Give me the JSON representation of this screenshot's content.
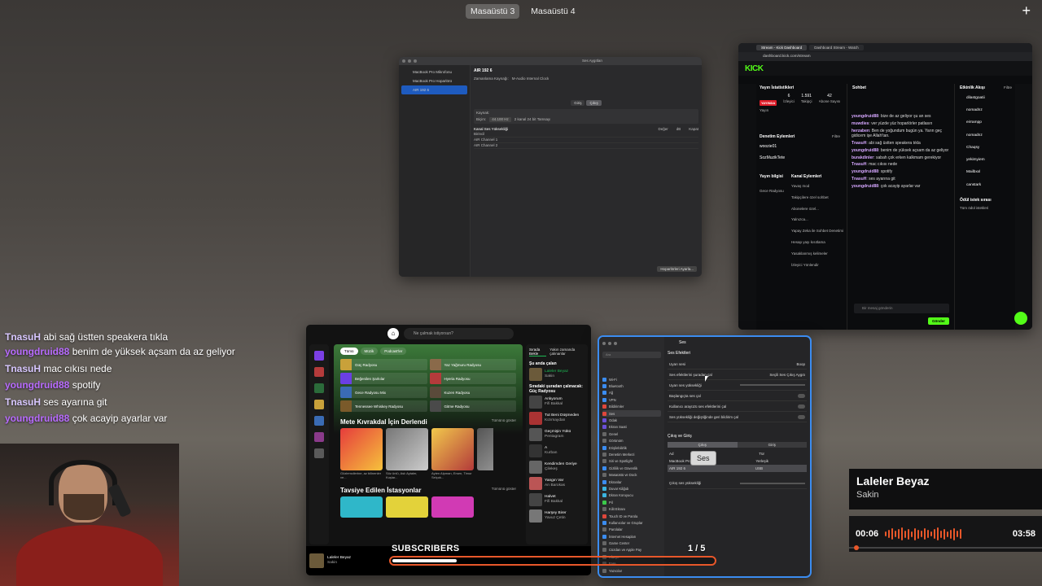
{
  "desktops": {
    "items": [
      "Masaüstü 3",
      "Masaüstü 4"
    ],
    "active": "Masaüstü 3"
  },
  "sound_window": {
    "title": "Ses Aygıtları",
    "devices": [
      "MacBook Pro Mikrofonu",
      "MacBook Pro Hoparlörü",
      "AIR 192 6"
    ],
    "selected_device": "AIR 192 6",
    "device_header": "AIR 192 6",
    "clock_source": "Zamanlama Kaynağı:",
    "clock_value": "M-Audio Internal Clock",
    "tab_input": "Giriş",
    "tab_output": "Çıkış",
    "source_label": "Kaynak:",
    "format_label": "Biçim:",
    "format_rate": "44.100 Hz",
    "format_bits": "2 kanal 24 bit Tamsayı",
    "channel_header": "Kanal Ses Yüksekliği",
    "channel_cols": [
      "Değer",
      "dB",
      "Kapat"
    ],
    "channels": [
      "Birincil",
      "AIR Channel 1",
      "AIR Channel 2"
    ],
    "configure_button": "Hoparlörleri Ayarla..."
  },
  "kick": {
    "tabs": [
      "Stream - Kick Dashboard",
      "Dashboard Stream - Watch"
    ],
    "url": "dashboard.kick.com/stream",
    "stream_info_title": "Yayın İstatistikleri",
    "live_badge": "YAYINDA",
    "stats": [
      {
        "value": "6",
        "label": "İzleyici"
      },
      {
        "value": "1.591",
        "label": "Takipçi"
      },
      {
        "value": "42",
        "label": "Abone Sayısı"
      }
    ],
    "stats_first_label": "Yayın",
    "moderation_title": "Denetim Eylemleri",
    "filter": "Filtre",
    "mod_actions": [
      "woozie01",
      "SozMuzikTete"
    ],
    "stream_title_label": "Yayın bilgisi",
    "channel_actions_title": "Kanal Eylemleri",
    "channel_actions": [
      "Yavaş mod",
      "Takipçilere özel sohbet",
      "Abonelere özel...",
      "Yalnızca...",
      "Yapay Zeka ile Sohbet Denetimi",
      "Hesap yaşı kısıtlama",
      "Yasaklanmış kelimeler",
      "İzleyici Yönlendir"
    ],
    "category": "Gece Radyosu",
    "chat_title": "Sohbet",
    "chat_lines": [
      {
        "user": "youngdruid88",
        "msg": "bize de az geliyor şu an ses"
      },
      {
        "user": "muwdies",
        "msg": "ver yüzde yüz hoparlörler patlasın"
      },
      {
        "user": "herzaben",
        "msg": "Ben de yoğundum bugün ya. Yarın geç gidicem işe Allah'tan."
      },
      {
        "user": "TnasuH",
        "msg": "abi sağ üstten speakera tıkla"
      },
      {
        "user": "youngdruid88",
        "msg": "benim de yüksek açsam da az geliyor"
      },
      {
        "user": "burakdinler",
        "msg": "sabah çok erken kalkmam gerekiyor"
      },
      {
        "user": "TnasuH",
        "msg": "mac cıkısı nede"
      },
      {
        "user": "youngdruid88",
        "msg": "spotify"
      },
      {
        "user": "TnasuH",
        "msg": "ses ayarına git"
      },
      {
        "user": "youngdruid88",
        "msg": "çok acayip ayarlar var"
      }
    ],
    "chat_placeholder": "Bir mesaj gönderin",
    "send_button": "Gönder",
    "activity_title": "Etkinlik Akışı",
    "activity_users": [
      "dilastgoatii",
      "nomadnz",
      "eirrampp",
      "nomadnz",
      "Chaqsy",
      "yekimyiem",
      "Mailbxxl",
      "canstark"
    ],
    "rewards_title": "Ödül istek sırası",
    "all_rewards": "Tüm ödül istekleri"
  },
  "spotify": {
    "search_placeholder": "Ne çalmak istiyorsun?",
    "chips": [
      "Tümü",
      "Müzik",
      "Podcast'ler"
    ],
    "grid": [
      "Güç Radyosu",
      "Yaz Yağmuru Radyosu",
      "Beğenilen Şarkılar",
      "Hyeria Radyosu",
      "Gece Radyosu Mix",
      "Kuzen Radyosu",
      "Tennessee Whiskey Radyosu",
      "Gitme Radyosu"
    ],
    "section1": "Mete Kıvrakdal İçin Derlendi",
    "section2": "Tavsiye Edilen İstasyonlar",
    "show_all": "Tümünü göster",
    "cards": [
      "Haftalık Keşif",
      "Daily Mix 01",
      "Daily Mix 02",
      "Daily Mix 03"
    ],
    "card_captions": [
      "Gözlemcilerine, az bilinenler ve...",
      "Söz ünlü, Aslı Aytaler, Kuşlar...",
      "Ayten Alpman, Ersen, Timur Selçuk...",
      ""
    ],
    "right_tabs": [
      "Sırada Bekle",
      "Yakın zamanda çalınanlar"
    ],
    "now_playing_header": "Şu anda çalan",
    "now_playing": {
      "title": "Laleler Beyaz",
      "artist": "Sakin"
    },
    "queue_header": "Sıradaki şuradan çalınacak: Güç Radyosu",
    "queue": [
      {
        "title": "Anlıyorum",
        "artist": "Fifi Bakkal"
      },
      {
        "title": "Tut Beni Düşmeden",
        "artist": "Kızımaydan"
      },
      {
        "title": "Geçmişin Yükü",
        "artist": "Pentagram"
      },
      {
        "title": "A",
        "artist": "Kurban"
      },
      {
        "title": "Kendimden Geriye",
        "artist": "Çilekeş"
      },
      {
        "title": "Yangın Var",
        "artist": "Arı Barokas"
      },
      {
        "title": "Halvet",
        "artist": "Fifi Bakkal"
      },
      {
        "title": "Harşey Birer",
        "artist": "Yavuz Çetin"
      }
    ],
    "player": {
      "title": "Laleler Beyaz",
      "artist": "Sakin"
    }
  },
  "settings": {
    "title": "Ses",
    "section": "Ses Efektleri",
    "search_placeholder": "Ara",
    "sidebar": [
      "Wi-Fi",
      "Bluetooth",
      "Ağ",
      "VPN",
      "Bildirimler",
      "Ses",
      "Odak",
      "Ekran Saati",
      "Genel",
      "Görünüm",
      "Erişilebilirlik",
      "Denetim Merkezi",
      "Siri ve Spotlight",
      "Gizlilik ve Güvenlik",
      "Masaüstü ve Dock",
      "Ekranlar",
      "Duvar Kâğıdı",
      "Ekran Koruyucu",
      "Pil",
      "Kilit Ekranı",
      "Touch ID ve Parola",
      "Kullanıcılar ve Gruplar",
      "Parolalar",
      "İnternet Hesapları",
      "Game Center",
      "Cüzdan ve Apple Pay",
      "Klavye",
      "Fare",
      "Yazıcılar"
    ],
    "selected": "Ses",
    "rows": [
      {
        "label": "Uyarı sesi",
        "value": "Boop"
      },
      {
        "label": "Ses efektlerini şuradan çal",
        "value": "Seçili Ses Çıkış Aygıtı"
      },
      {
        "label": "Uyarı ses yüksekliği",
        "value": ""
      },
      {
        "label": "Başlangıçta ses çal",
        "value": ""
      },
      {
        "label": "Kullanıcı arayüzü ses efektlerini çal",
        "value": ""
      },
      {
        "label": "Ses yüksekliği değiştiğinde geri bildirim çal",
        "value": ""
      }
    ],
    "io_title": "Çıkış ve Giriş",
    "seg": [
      "Çıkış",
      "Giriş"
    ],
    "table_cols": [
      "Ad",
      "Tür"
    ],
    "devices": [
      {
        "name": "MacBook Pro Hoparlörü",
        "type": "Yerleşik"
      },
      {
        "name": "AIR 192 6",
        "type": "USB"
      }
    ],
    "output_volume": "Çıkış ses yüksekliği",
    "tooltip": "Ses"
  },
  "chat_overlay": [
    {
      "user": "TnasuH",
      "msg": "abi sağ üstten speakera tıkla",
      "kind": "tn"
    },
    {
      "user": "youngdruid88",
      "msg": "benim de yüksek açsam da az geliyor",
      "kind": "yd"
    },
    {
      "user": "TnasuH",
      "msg": "mac cıkısı nede",
      "kind": "tn"
    },
    {
      "user": "youngdruid88",
      "msg": "spotify",
      "kind": "yd"
    },
    {
      "user": "TnasuH",
      "msg": "ses ayarına git",
      "kind": "tn"
    },
    {
      "user": "youngdruid88",
      "msg": "çok acayip ayarlar var",
      "kind": "yd"
    }
  ],
  "now_playing_widget": {
    "title": "Laleler Beyaz",
    "artist": "Sakin",
    "elapsed": "00:06",
    "total": "03:58",
    "progress": 0.025
  },
  "subscribers": {
    "label": "SUBSCRIBERS",
    "count": "1 / 5",
    "progress": 0.2
  },
  "colors": {
    "accent_orange": "#e8572a",
    "kick_green": "#53fc18",
    "spotify_green": "#1db954",
    "selection_blue": "#3b8cf0"
  }
}
